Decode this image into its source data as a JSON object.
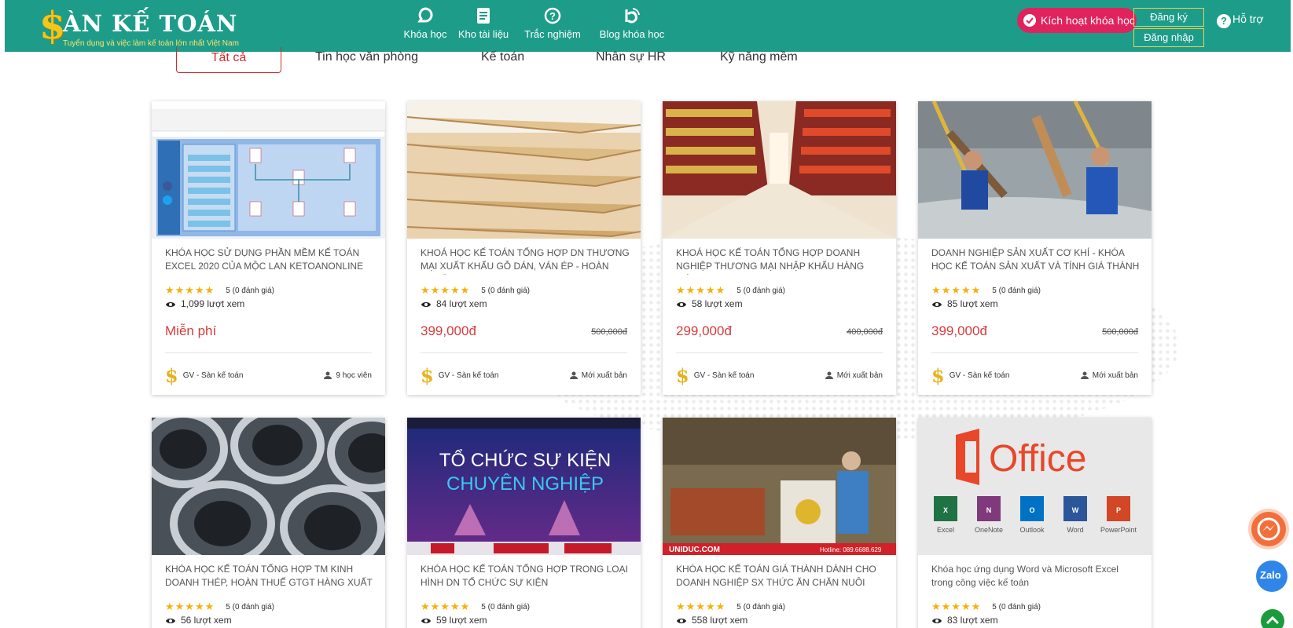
{
  "header": {
    "brand": "ÀN KẾ TOÁN",
    "brand_dollar": "$",
    "tagline": "Tuyển dụng và việc làm kế toán lớn nhất Việt Nam",
    "nav": [
      {
        "label": "Khóa học",
        "icon": "chat-bubble-icon"
      },
      {
        "label": "Kho tài liệu",
        "icon": "document-icon"
      },
      {
        "label": "Trắc nghiệm",
        "icon": "question-circle-icon"
      },
      {
        "label": "Blog khóa học",
        "icon": "rss-icon"
      }
    ],
    "activate_label": "Kích hoạt khóa học",
    "register_label": "Đăng ký",
    "login_label": "Đăng nhập",
    "help_label": "Hỗ trợ",
    "colors": {
      "bar": "#1e9c8a",
      "activate": "#e0225d",
      "accent_border": "#e6d15a"
    }
  },
  "tabs": [
    {
      "label": "Tất cả",
      "active": true
    },
    {
      "label": "Tin học văn phòng"
    },
    {
      "label": "Kế toán"
    },
    {
      "label": "Nhân sự HR"
    },
    {
      "label": "Kỹ năng mềm"
    }
  ],
  "courses": [
    {
      "title": "Khóa học sử dụng phần mềm kế toán Excel 2020 của Mộc Lan Ketoanonline",
      "rating": "5 (0 đánh giá)",
      "stars": "★★★★★",
      "views": "1,099 lượt xem",
      "price": "Miễn phí",
      "old_price": "",
      "teacher": "GV - Sàn kế toán",
      "meta": "9 học viên",
      "thumb": "excel-screenshot"
    },
    {
      "title": "Khoá học kế toán tổng hợp DN thương mại xuất khẩu gỗ dán, ván ép - hoàn thuế",
      "rating": "5 (0 đánh giá)",
      "stars": "★★★★★",
      "views": "84 lượt xem",
      "price": "399,000đ",
      "old_price": "500,000đ",
      "teacher": "GV - Sàn kế toán",
      "meta": "Mới xuất bản",
      "thumb": "plywood"
    },
    {
      "title": "Khoá học kế toán tổng hợp doanh nghiệp thương mại nhập khẩu hàng tiêu",
      "rating": "5 (0 đánh giá)",
      "stars": "★★★★★",
      "views": "58 lượt xem",
      "price": "299,000đ",
      "old_price": "400,000đ",
      "teacher": "GV - Sàn kế toán",
      "meta": "Mới xuất bản",
      "thumb": "supermarket"
    },
    {
      "title": "Doanh nghiệp sản xuất cơ khí - Khóa học kế toán sản xuất và tính giá thành",
      "rating": "5 (0 đánh giá)",
      "stars": "★★★★★",
      "views": "85 lượt xem",
      "price": "399,000đ",
      "old_price": "500,000đ",
      "teacher": "GV - Sàn kế toán",
      "meta": "Mới xuất bản",
      "thumb": "factory"
    },
    {
      "title": "Khóa học kế toán tổng hợp TM kinh doanh thép, hoàn thuế GTGT hàng xuất",
      "rating": "5 (0 đánh giá)",
      "stars": "★★★★★",
      "views": "56 lượt xem",
      "thumb": "steel-coils"
    },
    {
      "title": "Khóa học kế toán tổng hợp trong loại hình DN tổ chức sự kiện",
      "rating": "5 (0 đánh giá)",
      "stars": "★★★★★",
      "views": "59 lượt xem",
      "thumb": "event",
      "thumb_text_1": "TỔ CHỨC SỰ KIỆN",
      "thumb_text_2": "CHUYÊN NGHIỆP"
    },
    {
      "title": "Khóa học kế toán giá thành dành cho doanh nghiệp SX thức ăn chăn nuôi",
      "rating": "5 (0 đánh giá)",
      "stars": "★★★★★",
      "views": "558 lượt xem",
      "thumb": "feed-factory",
      "thumb_text_1": "UNIDUC.COM",
      "thumb_text_2": "Hotline: 089.6688.629"
    },
    {
      "title": "Khóa học ứng dụng Word và Microsoft Excel trong công việc kế toán",
      "rating": "5 (0 đánh giá)",
      "stars": "★★★★★",
      "views": "83 lượt xem",
      "thumb": "office",
      "thumb_text_1": "Office",
      "apps": [
        "Excel",
        "OneNote",
        "Outlook",
        "Word",
        "PowerPoint"
      ]
    }
  ],
  "widgets": {
    "zalo_label": "Zalo"
  }
}
